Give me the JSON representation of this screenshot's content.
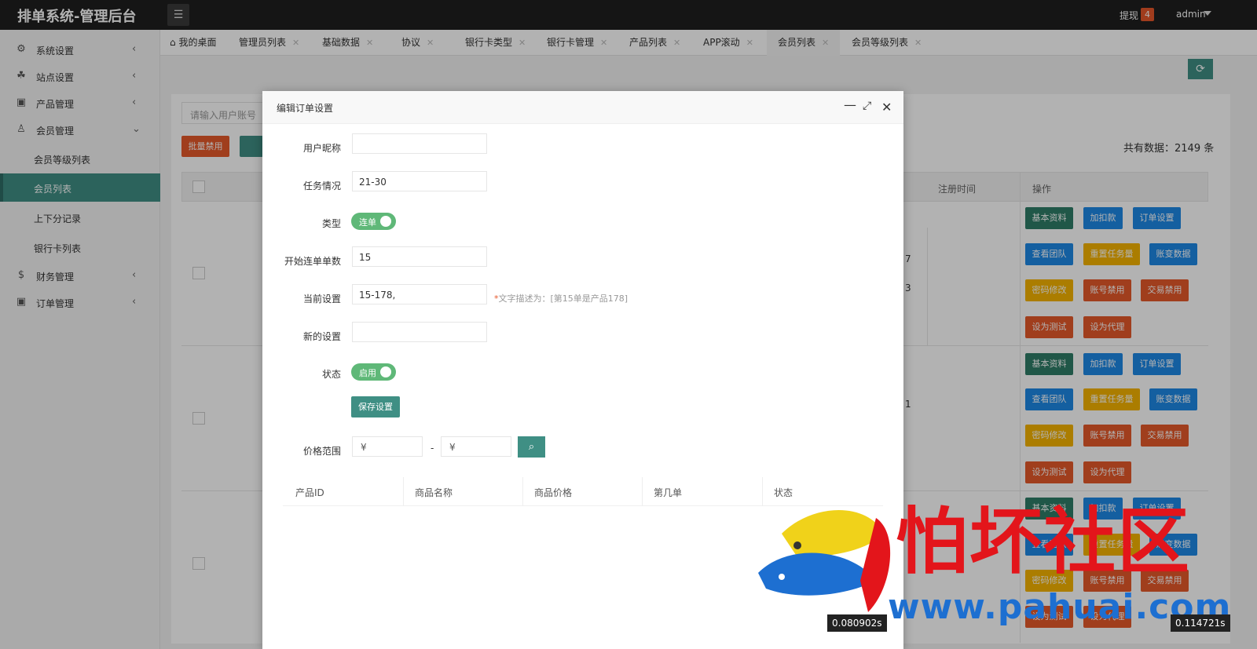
{
  "topbar": {
    "brand": "排单系统-管理后台",
    "withdraw_label": "提现",
    "withdraw_count": "4",
    "user": "admin"
  },
  "sidebar": {
    "items": [
      {
        "label": "系统设置",
        "icon": "gear-icon"
      },
      {
        "label": "站点设置",
        "icon": "site-icon"
      },
      {
        "label": "产品管理",
        "icon": "box-icon"
      },
      {
        "label": "会员管理",
        "icon": "user-icon"
      },
      {
        "label": "财务管理",
        "icon": "dollar-icon"
      },
      {
        "label": "订单管理",
        "icon": "box-icon"
      }
    ],
    "member_subitems": [
      "会员等级列表",
      "会员列表",
      "上下分记录",
      "银行卡列表"
    ],
    "active_subitem": "会员列表"
  },
  "tabs": [
    {
      "label": "我的桌面"
    },
    {
      "label": "管理员列表"
    },
    {
      "label": "基础数据"
    },
    {
      "label": "协议"
    },
    {
      "label": "银行卡类型"
    },
    {
      "label": "银行卡管理"
    },
    {
      "label": "产品列表"
    },
    {
      "label": "APP滚动"
    },
    {
      "label": "会员列表"
    },
    {
      "label": "会员等级列表"
    }
  ],
  "tab_close_glyph": "✕",
  "page": {
    "search_placeholder": "请输入用户账号",
    "batch_disable": "批量禁用",
    "total_text": "共有数据：2149 条",
    "col_register_time": "注册时间",
    "col_action": "操作",
    "row_numbers": [
      "7",
      "3",
      "1"
    ],
    "actions": {
      "basic": "基本资料",
      "adjust": "加扣款",
      "order_settings": "订单设置",
      "view_team": "查看团队",
      "reset_tasks": "重置任务量",
      "account_changes": "账变数据",
      "change_password": "密码修改",
      "disable_account": "账号禁用",
      "disable_trade": "交易禁用",
      "set_test": "设为测试",
      "set_agent": "设为代理"
    }
  },
  "colors": {
    "accent": "#3f8f84",
    "green_btn": "#2e7d67",
    "blue_btn": "#1e88e5",
    "yellow_btn": "#f5b400",
    "orange_btn": "#e65a2a",
    "switch_on": "#5fb878",
    "badge": "#e6572a"
  },
  "modal": {
    "title": "编辑订单设置",
    "fields": {
      "nickname_label": "用户昵称",
      "nickname_value": "",
      "task_label": "任务情况",
      "task_value": "21-30",
      "type_label": "类型",
      "type_switch": "连单",
      "start_label": "开始连单单数",
      "start_value": "15",
      "current_label": "当前设置",
      "current_value": "15-178,",
      "current_hint": "文字描述为：[第15单是产品178]",
      "new_label": "新的设置",
      "new_value": "",
      "status_label": "状态",
      "status_switch": "启用"
    },
    "save_button": "保存设置",
    "price_label": "价格范围",
    "price_min_placeholder": "¥",
    "price_max_placeholder": "¥",
    "price_dash": "-",
    "table_headers": [
      "产品ID",
      "商品名称",
      "商品价格",
      "第几单",
      "状态"
    ]
  },
  "watermark": {
    "title": "怕坏社区",
    "url": "www.pahuai.com"
  },
  "timers": [
    "0.080902s",
    "0.114721s"
  ]
}
